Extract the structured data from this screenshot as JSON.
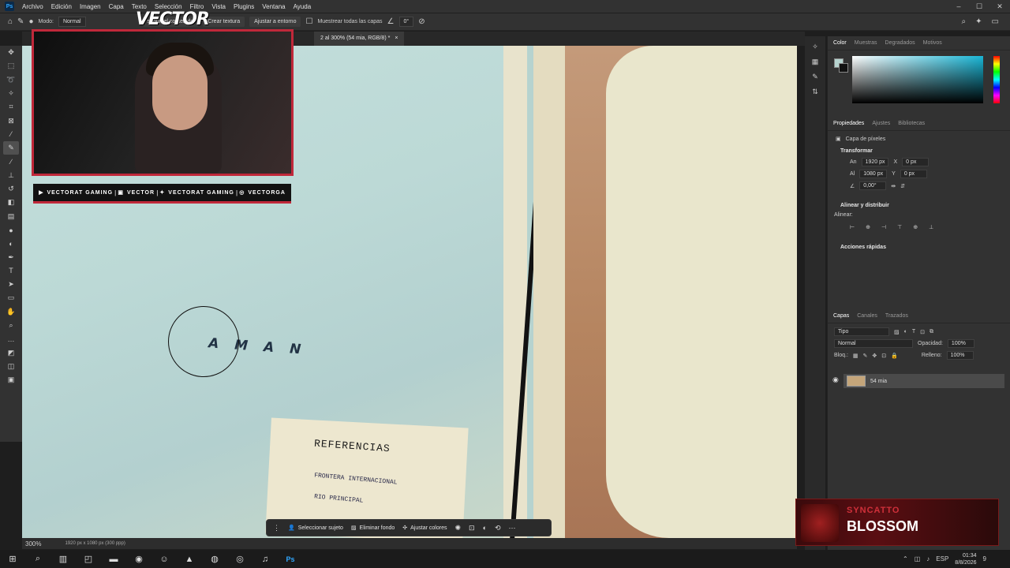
{
  "menu": {
    "items": [
      "Archivo",
      "Edición",
      "Imagen",
      "Capa",
      "Texto",
      "Selección",
      "Filtro",
      "Vista",
      "Plugins",
      "Ventana",
      "Ayuda"
    ]
  },
  "options": {
    "mode_label": "Modo:",
    "mode_value": "Normal",
    "content_btn": "según el contenido",
    "texture_btn": "Crear textura",
    "adjust_btn": "Ajustar a entorno",
    "sample_label": "Muestrear todas las capas",
    "angle_value": "0°"
  },
  "document": {
    "tab_title": "2 al 300% (54 mia, RGB/8) *",
    "map_label": "AMAN",
    "ref_title": "REFERENCIAS",
    "ref_row1": "FRONTERA INTERNACIONAL",
    "ref_row2": "RIO PRINCIPAL"
  },
  "overlay": {
    "logo": "VECTOR",
    "socials": [
      {
        "icon": "youtube-icon",
        "label": "VECTORAT GAMING"
      },
      {
        "icon": "twitch-icon",
        "label": "VECTOR"
      },
      {
        "icon": "twitter-icon",
        "label": "VECTORAT GAMING"
      },
      {
        "icon": "instagram-icon",
        "label": "VECTORGA"
      }
    ]
  },
  "context_bar": {
    "select_subject": "Seleccionar sujeto",
    "remove_bg": "Eliminar fondo",
    "adjust_colors": "Ajustar colores"
  },
  "status": {
    "zoom": "300%",
    "dims": "1920 px x 1080 px (300 ppp)"
  },
  "panels": {
    "color_tabs": [
      "Color",
      "Muestras",
      "Degradados",
      "Motivos"
    ],
    "props_tabs": [
      "Propiedades",
      "Ajustes",
      "Bibliotecas"
    ],
    "layer_type": "Capa de píxeles",
    "transform_title": "Transformar",
    "width_label": "An",
    "width_value": "1920 px",
    "x_label": "X",
    "x_value": "0 px",
    "height_label": "Al",
    "height_value": "1080 px",
    "y_label": "Y",
    "y_value": "0 px",
    "angle_value": "0,00°",
    "align_title": "Alinear y distribuir",
    "align_label": "Alinear:",
    "quick_title": "Acciones rápidas",
    "layers_tabs": [
      "Capas",
      "Canales",
      "Trazados"
    ],
    "filter_value": "Tipo",
    "blend_value": "Normal",
    "opacity_label": "Opacidad:",
    "opacity_value": "100%",
    "lock_label": "Bloq.:",
    "fill_label": "Relleno:",
    "fill_value": "100%",
    "layer_name": "54 mia"
  },
  "now_playing": {
    "artist": "SYNCATTO",
    "title": "BLOSSOM"
  },
  "taskbar": {
    "lang": "ESP",
    "time": "01:34",
    "date": "8/8/2026",
    "notif": "9"
  },
  "colors": {
    "accent_red": "#c0283a",
    "foreground": "#b6d3cf"
  }
}
